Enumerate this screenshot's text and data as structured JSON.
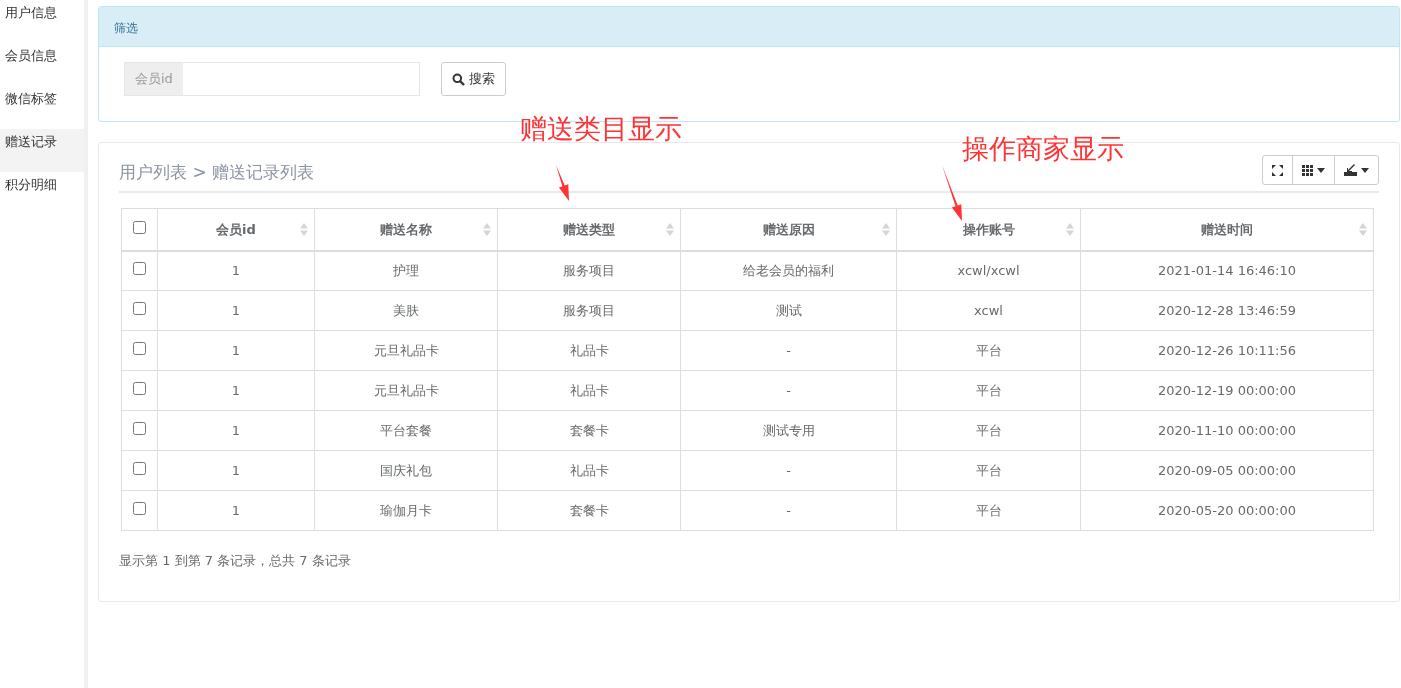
{
  "sidebar": {
    "items": [
      {
        "label": "用户信息",
        "selected": false
      },
      {
        "label": "会员信息",
        "selected": false
      },
      {
        "label": "微信标签",
        "selected": false
      },
      {
        "label": "赠送记录",
        "selected": true
      },
      {
        "label": "积分明细",
        "selected": false
      }
    ]
  },
  "filter": {
    "title": "筛选",
    "field": {
      "label": "会员id"
    },
    "search_button": "搜索"
  },
  "list": {
    "breadcrumb": "用户列表 > 赠送记录列表",
    "table": {
      "select_all_checked": false,
      "columns": [
        "会员id",
        "赠送名称",
        "赠送类型",
        "赠送原因",
        "操作账号",
        "赠送时间"
      ],
      "rows": [
        {
          "checked": false,
          "cells": [
            "1",
            "护理",
            "服务项目",
            "给老会员的福利",
            "xcwl/xcwl",
            "2021-01-14 16:46:10"
          ]
        },
        {
          "checked": false,
          "cells": [
            "1",
            "美肤",
            "服务项目",
            "测试",
            "xcwl",
            "2020-12-28 13:46:59"
          ]
        },
        {
          "checked": false,
          "cells": [
            "1",
            "元旦礼品卡",
            "礼品卡",
            "-",
            "平台",
            "2020-12-26 10:11:56"
          ]
        },
        {
          "checked": false,
          "cells": [
            "1",
            "元旦礼品卡",
            "礼品卡",
            "-",
            "平台",
            "2020-12-19 00:00:00"
          ]
        },
        {
          "checked": false,
          "cells": [
            "1",
            "平台套餐",
            "套餐卡",
            "测试专用",
            "平台",
            "2020-11-10 00:00:00"
          ]
        },
        {
          "checked": false,
          "cells": [
            "1",
            "国庆礼包",
            "礼品卡",
            "-",
            "平台",
            "2020-09-05 00:00:00"
          ]
        },
        {
          "checked": false,
          "cells": [
            "1",
            "瑜伽月卡",
            "套餐卡",
            "-",
            "平台",
            "2020-05-20 00:00:00"
          ]
        }
      ]
    },
    "pagination_info": "显示第 1 到第 7 条记录，总共 7 条记录"
  },
  "annotations": [
    {
      "text": "赠送类目显示"
    },
    {
      "text": "操作商家显示"
    }
  ]
}
